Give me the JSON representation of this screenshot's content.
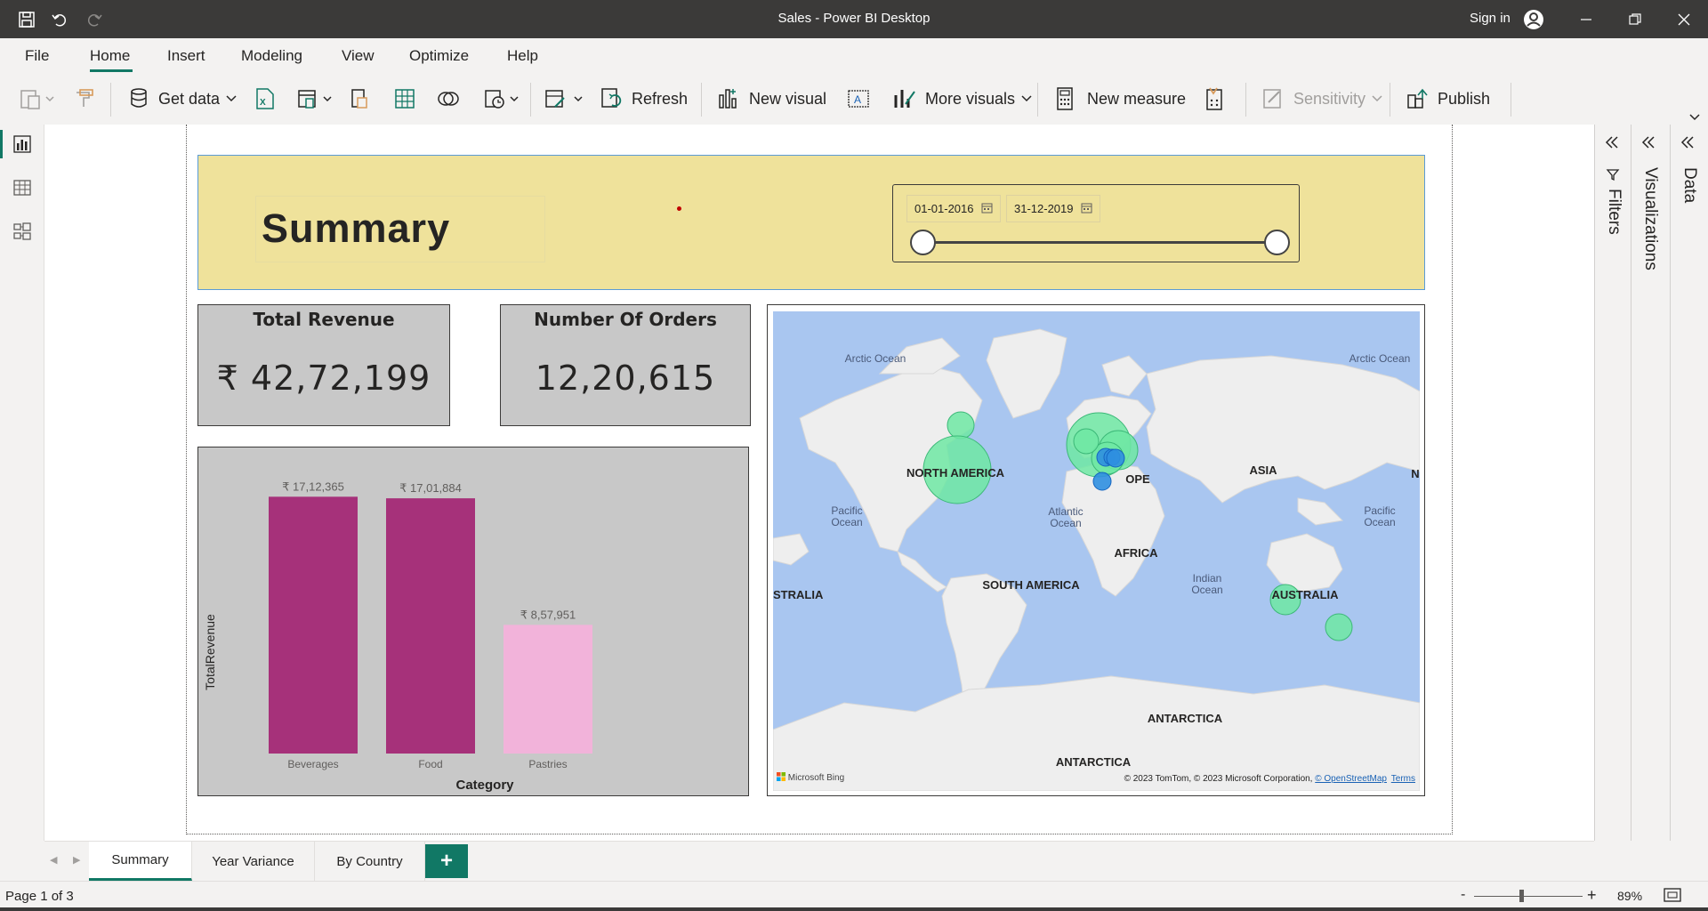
{
  "titlebar": {
    "title": "Sales - Power BI Desktop",
    "sign_in": "Sign in"
  },
  "menu": {
    "items": [
      "File",
      "Home",
      "Insert",
      "Modeling",
      "View",
      "Optimize",
      "Help"
    ],
    "active": "Home"
  },
  "ribbon": {
    "get_data": "Get data",
    "refresh": "Refresh",
    "new_visual": "New visual",
    "more_visuals": "More visuals",
    "new_measure": "New measure",
    "sensitivity": "Sensitivity",
    "publish": "Publish"
  },
  "header": {
    "title": "Summary",
    "date_start": "01-01-2016",
    "date_end": "31-12-2019"
  },
  "cards": {
    "total_revenue": {
      "title": "Total Revenue",
      "value": "₹ 42,72,199"
    },
    "orders": {
      "title": "Number Of Orders",
      "value": "12,20,615"
    }
  },
  "chart_data": {
    "type": "bar",
    "categories": [
      "Beverages",
      "Food",
      "Pastries"
    ],
    "values": [
      1712365,
      1701884,
      857951
    ],
    "data_labels": [
      "₹ 17,12,365",
      "₹ 17,01,884",
      "₹ 8,57,951"
    ],
    "colors": [
      "#a6317a",
      "#a6317a",
      "#f2b3da"
    ],
    "xlabel": "Category",
    "ylabel": "TotalRevenue",
    "ylim": [
      0,
      1750000
    ],
    "grid": false
  },
  "map": {
    "labels": {
      "north_america": "NORTH AMERICA",
      "south_america": "SOUTH AMERICA",
      "europe": "OPE",
      "asia": "ASIA",
      "africa": "AFRICA",
      "australia": "AUSTRALIA",
      "australia_left": "STRALIA",
      "antarctica_1": "ANTARCTICA",
      "antarctica_2": "ANTARCTICA",
      "arctic_left": "Arctic Ocean",
      "arctic_right": "Arctic Ocean",
      "pacific_left": "Pacific Ocean",
      "pacific_right": "Pacific Ocean",
      "atlantic": "Atlantic Ocean",
      "indian": "Indian Ocean",
      "edge_n": "N"
    },
    "attribution": "© 2023 TomTom, © 2023 Microsoft Corporation,",
    "osm": "© OpenStreetMap",
    "terms": "Terms",
    "bing": "Microsoft Bing",
    "bubble_colors": {
      "green": "#6ee8a3",
      "blue": "#2f8fe0"
    }
  },
  "panes": {
    "filters": "Filters",
    "visualizations": "Visualizations",
    "data": "Data"
  },
  "pages": {
    "tabs": [
      "Summary",
      "Year Variance",
      "By Country"
    ],
    "active": "Summary",
    "add": "+"
  },
  "status": {
    "page_info": "Page 1 of 3",
    "zoom": "89%",
    "zoom_level": 0.89
  }
}
